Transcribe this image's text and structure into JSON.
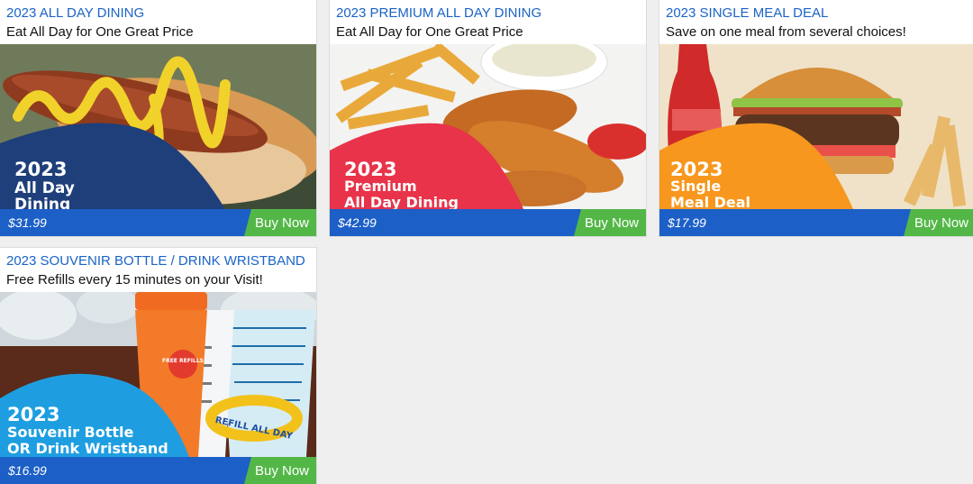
{
  "cards": [
    {
      "title": "2023 ALL DAY DINING",
      "subtitle": "Eat All Day for One Great Price",
      "badge_lines": [
        "2023",
        "All Day",
        "Dining"
      ],
      "badge_color": "#1e3f7a",
      "price": "$31.99",
      "buy_label": "Buy Now"
    },
    {
      "title": "2023 PREMIUM ALL DAY DINING",
      "subtitle": "Eat All Day for One Great Price",
      "badge_lines": [
        "2023",
        "Premium",
        "All Day Dining"
      ],
      "badge_color": "#e8334a",
      "price": "$42.99",
      "buy_label": "Buy Now"
    },
    {
      "title": "2023 SINGLE MEAL DEAL",
      "subtitle": "Save on one meal from several choices!",
      "badge_lines": [
        "2023",
        "Single",
        "Meal Deal"
      ],
      "badge_color": "#f7971e",
      "price": "$17.99",
      "buy_label": "Buy Now"
    },
    {
      "title": "2023 SOUVENIR BOTTLE / DRINK WRISTBAND",
      "subtitle": "Free Refills every 15 minutes on your Visit!",
      "badge_lines": [
        "2023",
        "Souvenir Bottle",
        "OR Drink Wristband"
      ],
      "badge_color": "#1e9ee0",
      "wristband_text": "REFILL ALL DAY",
      "cup_text": "FREE REFILLS",
      "price": "$16.99",
      "buy_label": "Buy Now"
    }
  ],
  "colors": {
    "title_blue": "#1a63c6",
    "price_bar": "#1c5fc7",
    "buy_green": "#53b747",
    "page_bg": "#efefef"
  }
}
